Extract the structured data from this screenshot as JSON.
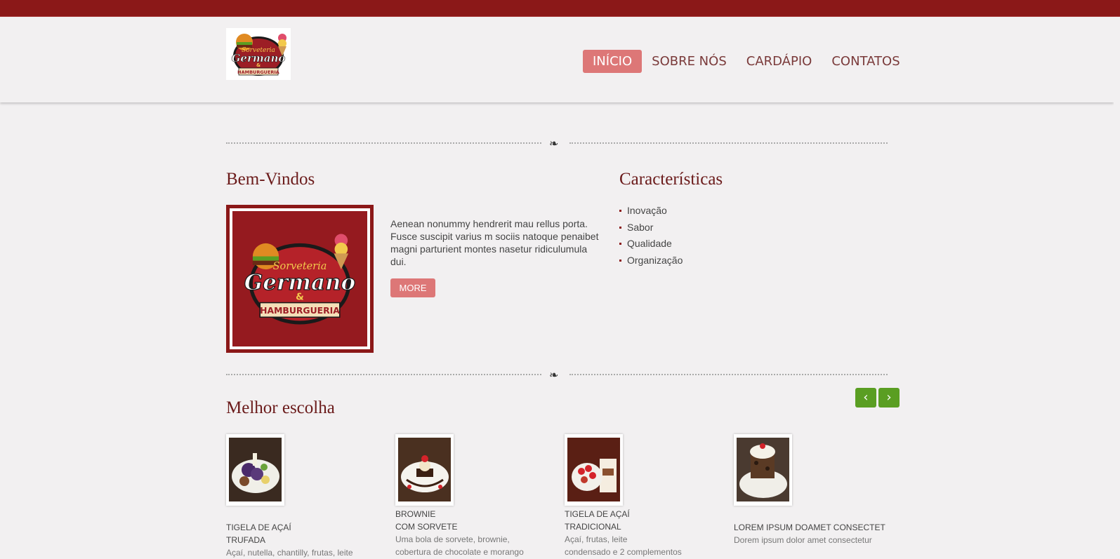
{
  "header": {
    "logo_alt": "Sorveteria Germano & Hamburgueria",
    "logo_text_top": "Sorveteria",
    "logo_text_main": "Germano",
    "logo_text_amp": "&",
    "logo_text_bottom": "HAMBURGUERIA",
    "nav": [
      {
        "label": "INÍCIO",
        "active": true
      },
      {
        "label": "SOBRE NÓS",
        "active": false
      },
      {
        "label": "CARDÁPIO",
        "active": false
      },
      {
        "label": "CONTATOS",
        "active": false
      }
    ]
  },
  "welcome": {
    "title": "Bem-Vindos",
    "text": "Aenean nonummy hendrerit mau rellus porta. Fusce suscipit varius m sociis natoque penaibet magni parturient montes nasetur ridiculumula dui.",
    "more_label": "MORE"
  },
  "features": {
    "title": "Características",
    "items": [
      "Inovação",
      "Sabor",
      "Qualidade",
      "Organização"
    ]
  },
  "best": {
    "title": "Melhor escolha",
    "prev_icon": "chevron-left-icon",
    "next_icon": "chevron-right-icon",
    "products": [
      {
        "title_line1": "TIGELA DE AÇAÍ",
        "title_line2": "TRUFADA",
        "desc_line1": "Açaí, nutella, chantilly, frutas, leite",
        "desc_line2": ""
      },
      {
        "title_line1": "BROWNIE",
        "title_line2": "COM SORVETE",
        "desc_line1": "Uma bola de sorvete, brownie,",
        "desc_line2": "cobertura de chocolate e morango"
      },
      {
        "title_line1": "TIGELA DE AÇAÍ",
        "title_line2": "TRADICIONAL",
        "desc_line1": "Açaí, frutas, leite",
        "desc_line2": "condensado e 2 complementos"
      },
      {
        "title_line1": "LOREM IPSUM DOAMET CONSECTET",
        "title_line2": "",
        "desc_line1": "Dorem ipsum dolor amet consectetur",
        "desc_line2": ""
      }
    ]
  },
  "colors": {
    "brand_dark_red": "#8b1818",
    "accent_pink": "#dd7777",
    "heading_red": "#6b1b1b",
    "carousel_green": "#5a9e22",
    "background": "#f2f0f1"
  }
}
